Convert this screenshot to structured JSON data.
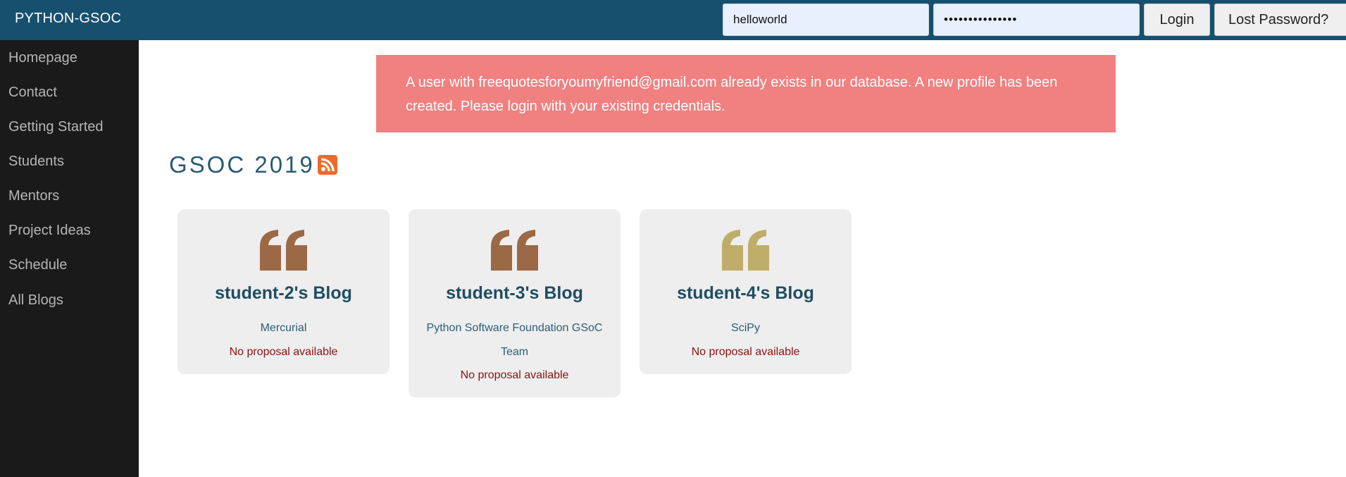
{
  "header": {
    "brand": "PYTHON-GSOC",
    "username_value": "helloworld",
    "password_value": "•••••••••••••••",
    "login_label": "Login",
    "lost_password_label": "Lost Password?"
  },
  "sidebar": {
    "items": [
      {
        "label": "Homepage"
      },
      {
        "label": "Contact"
      },
      {
        "label": "Getting Started"
      },
      {
        "label": "Students"
      },
      {
        "label": "Mentors"
      },
      {
        "label": "Project Ideas"
      },
      {
        "label": "Schedule"
      },
      {
        "label": "All Blogs"
      }
    ]
  },
  "alert": {
    "message": "A user with freequotesforyoumyfriend@gmail.com already exists in our database. A new profile has been created. Please login with your existing credentials.",
    "color": "#f18080"
  },
  "main": {
    "title": "GSOC 2019",
    "rss_icon": "rss-icon",
    "blogs": [
      {
        "name": "student-2's Blog",
        "org": "Mercurial",
        "proposal": "No proposal available",
        "quote_color": "#9c6947"
      },
      {
        "name": "student-3's Blog",
        "org": "Python Software Foundation GSoC Team",
        "proposal": "No proposal available",
        "quote_color": "#9c6947"
      },
      {
        "name": "student-4's Blog",
        "org": "SciPy",
        "proposal": "No proposal available",
        "quote_color": "#bfad6a"
      }
    ]
  },
  "colors": {
    "topbar": "#17506f",
    "sidebar": "#1a1a1a",
    "title": "#285a73",
    "proposal": "#8b1212"
  }
}
